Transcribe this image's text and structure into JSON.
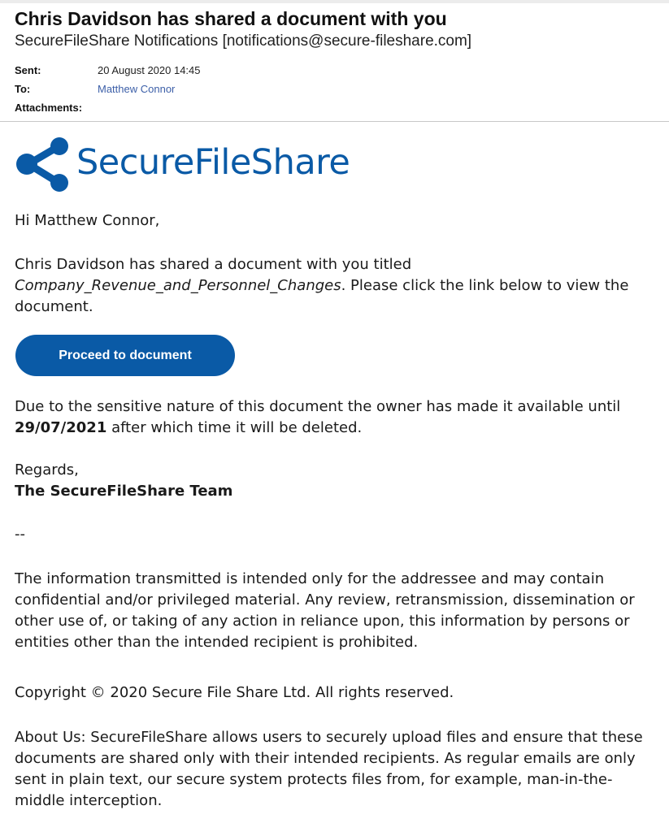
{
  "email": {
    "subject": "Chris Davidson has shared a document with you",
    "from": "SecureFileShare Notifications [notifications@secure-fileshare.com]",
    "sent_label": "Sent:",
    "sent_value": "20 August 2020 14:45",
    "to_label": "To:",
    "to_value": "Matthew Connor",
    "attachments_label": "Attachments:"
  },
  "brand": {
    "name": "SecureFileShare",
    "icon": "share-icon",
    "color": "#0a5aa6"
  },
  "body": {
    "greeting": "Hi Matthew Connor,",
    "share_intro": "Chris Davidson has shared a document with you titled",
    "doc_title": "Company_Revenue_and_Personnel_Changes",
    "share_suffix": ". Please click the link below to view the document.",
    "cta_label": "Proceed to document",
    "expiry_prefix": "Due to the sensitive nature of this document the owner has made it available until",
    "expiry_date": "29/07/2021",
    "expiry_suffix": "after which time it will be deleted.",
    "regards": "Regards,",
    "team": "The SecureFileShare Team",
    "separator": "--",
    "disclaimer": "The information transmitted is intended only for the addressee and may contain confidential and/or privileged material. Any review, retransmission, dissemination or other use of, or taking of any action in reliance upon, this information by persons or entities other than the intended recipient is prohibited.",
    "copyright": "Copyright © 2020 Secure File Share Ltd. All rights reserved.",
    "about": "About Us: SecureFileShare allows users to securely upload files and ensure that these documents are shared only with their intended recipients. As regular emails are only sent in plain text, our secure system protects files from, for example, man-in-the-middle interception."
  }
}
